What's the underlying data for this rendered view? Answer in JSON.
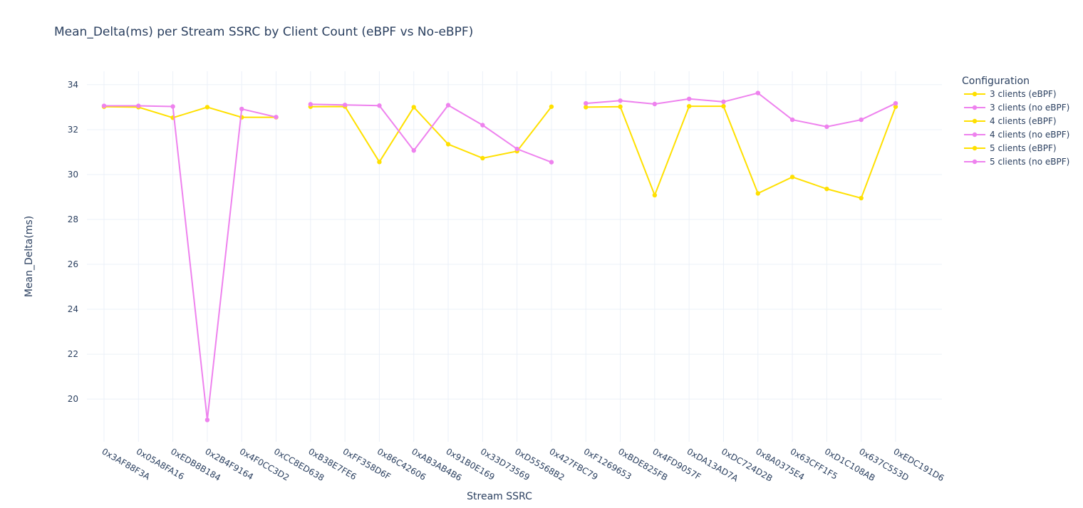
{
  "chart_data": {
    "type": "line",
    "title": "Mean_Delta(ms) per Stream SSRC by Client Count (eBPF vs No-eBPF)",
    "xlabel": "Stream SSRC",
    "ylabel": "Mean_Delta(ms)",
    "ylim": [
      18.1,
      34.6
    ],
    "yticks": [
      20,
      22,
      24,
      26,
      28,
      30,
      32,
      34
    ],
    "grid": true,
    "legend": {
      "title": "Configuration",
      "position": "top-right"
    },
    "categories": [
      "0x3AF88F3A",
      "0x05A8FA16",
      "0xEDB8B184",
      "0x2B4F9164",
      "0x4F0CC3D2",
      "0xCC8ED638",
      "0xB38E7FE6",
      "0xFF358D6F",
      "0x86C42606",
      "0xAB3AB4B6",
      "0x91B0E169",
      "0x33D73569",
      "0xD55568B2",
      "0x427FBC79",
      "0xF1269653",
      "0xBDE825FB",
      "0x4FD9057F",
      "0xDA13AD7A",
      "0xDC724D2B",
      "0x8A0375E4",
      "0x63CFF1F5",
      "0xD1C108AB",
      "0x637C553D",
      "0xEDC191D6"
    ],
    "series": [
      {
        "name": "3 clients (eBPF)",
        "color": "#FFE000",
        "x": [
          "0x3AF88F3A",
          "0x05A8FA16",
          "0xEDB8B184",
          "0x2B4F9164",
          "0x4F0CC3D2",
          "0xCC8ED638"
        ],
        "y": [
          33.02,
          33.0,
          32.53,
          33.0,
          32.55,
          32.55
        ]
      },
      {
        "name": "3 clients (no eBPF)",
        "color": "#EE82EE",
        "x": [
          "0x3AF88F3A",
          "0x05A8FA16",
          "0xEDB8B184",
          "0x2B4F9164",
          "0x4F0CC3D2",
          "0xCC8ED638"
        ],
        "y": [
          33.06,
          33.06,
          33.03,
          19.07,
          32.92,
          32.56
        ]
      },
      {
        "name": "4 clients (eBPF)",
        "color": "#FFE000",
        "x": [
          "0xB38E7FE6",
          "0xFF358D6F",
          "0x86C42606",
          "0xAB3AB4B6",
          "0x91B0E169",
          "0x33D73569",
          "0xD55568B2",
          "0x427FBC79"
        ],
        "y": [
          33.02,
          33.03,
          30.56,
          33.0,
          31.35,
          30.73,
          31.04,
          33.02
        ]
      },
      {
        "name": "4 clients (no eBPF)",
        "color": "#EE82EE",
        "x": [
          "0xB38E7FE6",
          "0xFF358D6F",
          "0x86C42606",
          "0xAB3AB4B6",
          "0x91B0E169",
          "0x33D73569",
          "0xD55568B2",
          "0x427FBC79"
        ],
        "y": [
          33.13,
          33.1,
          33.07,
          31.07,
          33.09,
          32.2,
          31.14,
          30.55
        ]
      },
      {
        "name": "5 clients (eBPF)",
        "color": "#FFE000",
        "x": [
          "0xF1269653",
          "0xBDE825FB",
          "0x4FD9057F",
          "0xDA13AD7A",
          "0xDC724D2B",
          "0x8A0375E4",
          "0x63CFF1F5",
          "0xD1C108AB",
          "0x637C553D",
          "0xEDC191D6"
        ],
        "y": [
          33.0,
          33.02,
          29.08,
          33.04,
          33.04,
          29.16,
          29.89,
          29.36,
          28.95,
          33.02
        ]
      },
      {
        "name": "5 clients (no eBPF)",
        "color": "#EE82EE",
        "x": [
          "0xF1269653",
          "0xBDE825FB",
          "0x4FD9057F",
          "0xDA13AD7A",
          "0xDC724D2B",
          "0x8A0375E4",
          "0x63CFF1F5",
          "0xD1C108AB",
          "0x637C553D",
          "0xEDC191D6"
        ],
        "y": [
          33.17,
          33.29,
          33.14,
          33.37,
          33.24,
          33.63,
          32.44,
          32.13,
          32.44,
          33.17
        ]
      }
    ]
  }
}
